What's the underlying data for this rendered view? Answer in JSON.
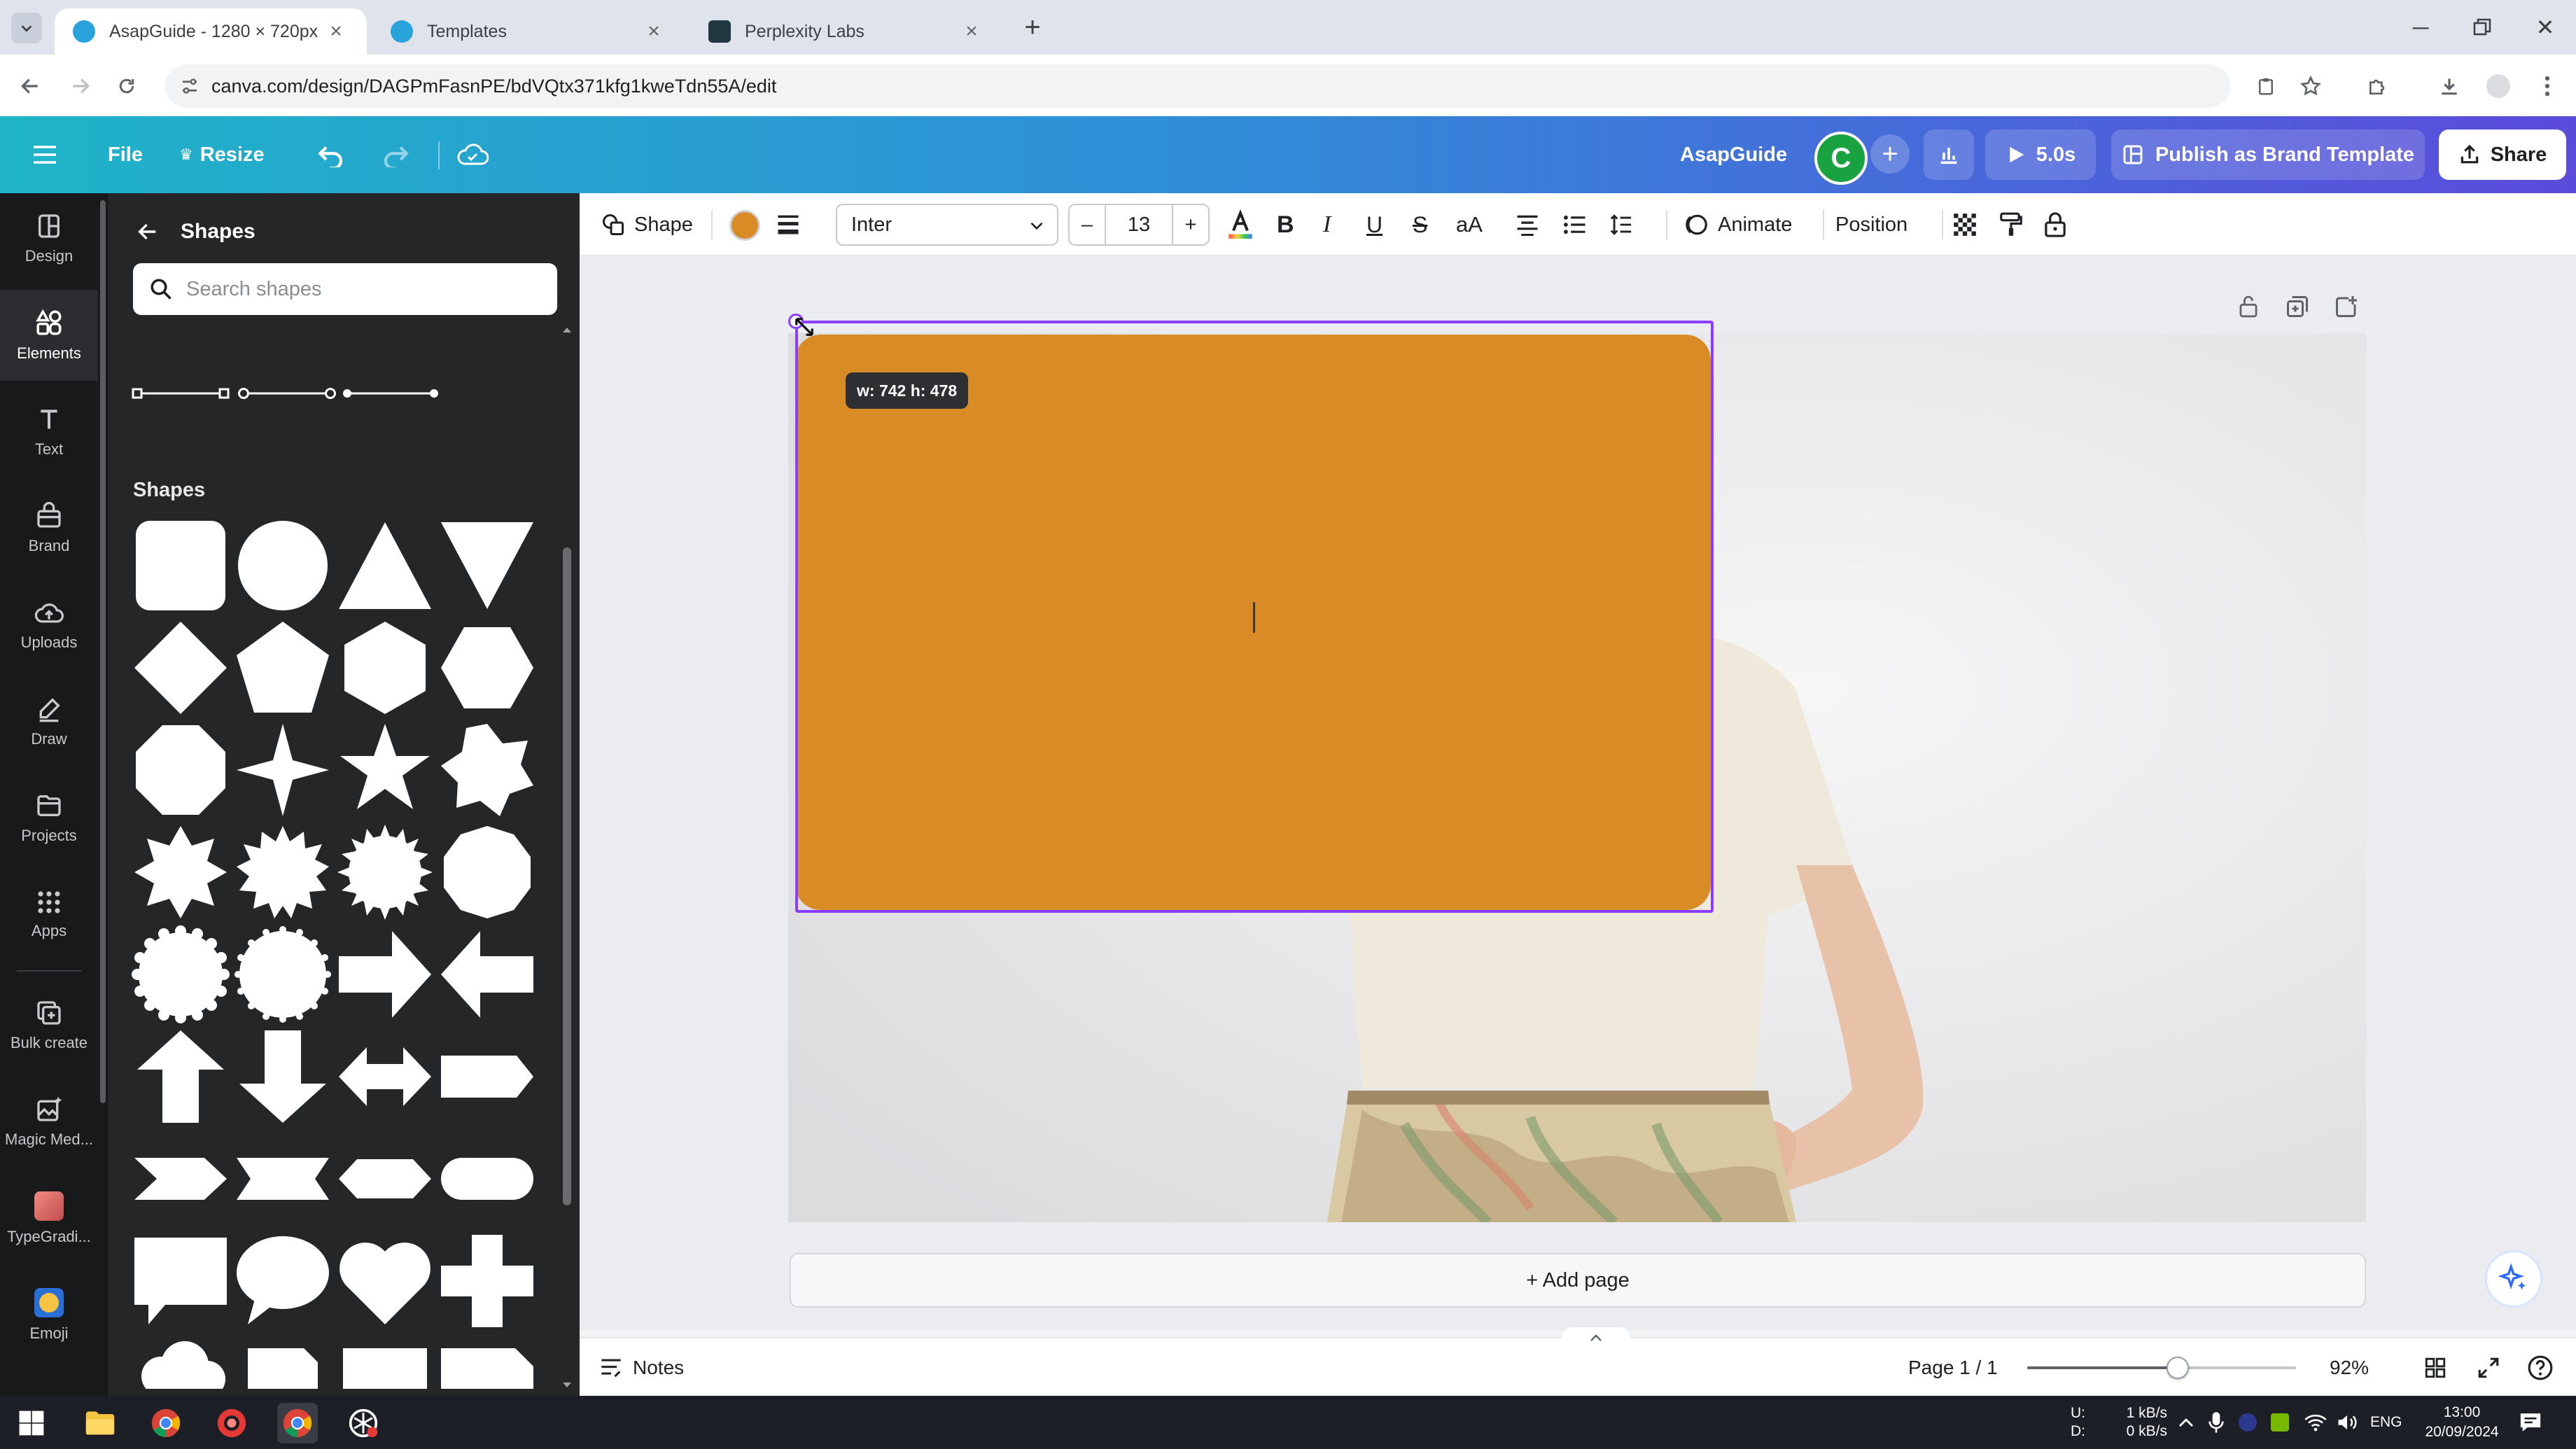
{
  "browser": {
    "tabs": [
      {
        "title": "AsapGuide - 1280 × 720px",
        "active": true
      },
      {
        "title": "Templates",
        "active": false
      },
      {
        "title": "Perplexity Labs",
        "active": false
      }
    ],
    "url": "canva.com/design/DAGPmFasnPE/bdVQtx371kfg1kweTdn55A/edit"
  },
  "topbar": {
    "file": "File",
    "resize": "Resize",
    "project_name": "AsapGuide",
    "avatar_initial": "C",
    "play_duration": "5.0s",
    "publish": "Publish as Brand Template",
    "share": "Share"
  },
  "rail": {
    "items": [
      {
        "label": "Design",
        "icon": "design-icon"
      },
      {
        "label": "Elements",
        "icon": "elements-icon"
      },
      {
        "label": "Text",
        "icon": "text-icon"
      },
      {
        "label": "Brand",
        "icon": "brand-icon"
      },
      {
        "label": "Uploads",
        "icon": "uploads-icon"
      },
      {
        "label": "Draw",
        "icon": "draw-icon"
      },
      {
        "label": "Projects",
        "icon": "projects-icon"
      },
      {
        "label": "Apps",
        "icon": "apps-icon"
      },
      {
        "label": "Bulk create",
        "icon": "bulk-create-icon"
      },
      {
        "label": "Magic Med...",
        "icon": "magic-media-icon"
      },
      {
        "label": "TypeGradi...",
        "icon": "typegradient-icon"
      },
      {
        "label": "Emoji",
        "icon": "emoji-icon"
      }
    ]
  },
  "panel": {
    "title": "Shapes",
    "search_placeholder": "Search shapes",
    "section_label": "Shapes"
  },
  "toolbar": {
    "shape": "Shape",
    "font": "Inter",
    "font_size": "13",
    "animate": "Animate",
    "position": "Position"
  },
  "canvas": {
    "size_tooltip": "w: 742 h: 478",
    "add_page": "+ Add page",
    "shape_color": "#d98c25",
    "accent": "#8b3dff"
  },
  "footer": {
    "notes": "Notes",
    "page_indicator": "Page 1 / 1",
    "zoom": "92%",
    "zoom_level": 0.56
  },
  "taskbar": {
    "upload_label": "U:",
    "download_label": "D:",
    "upload_rate": "1 kB/s",
    "download_rate": "0 kB/s",
    "language": "ENG",
    "time": "13:00",
    "date": "20/09/2024"
  }
}
